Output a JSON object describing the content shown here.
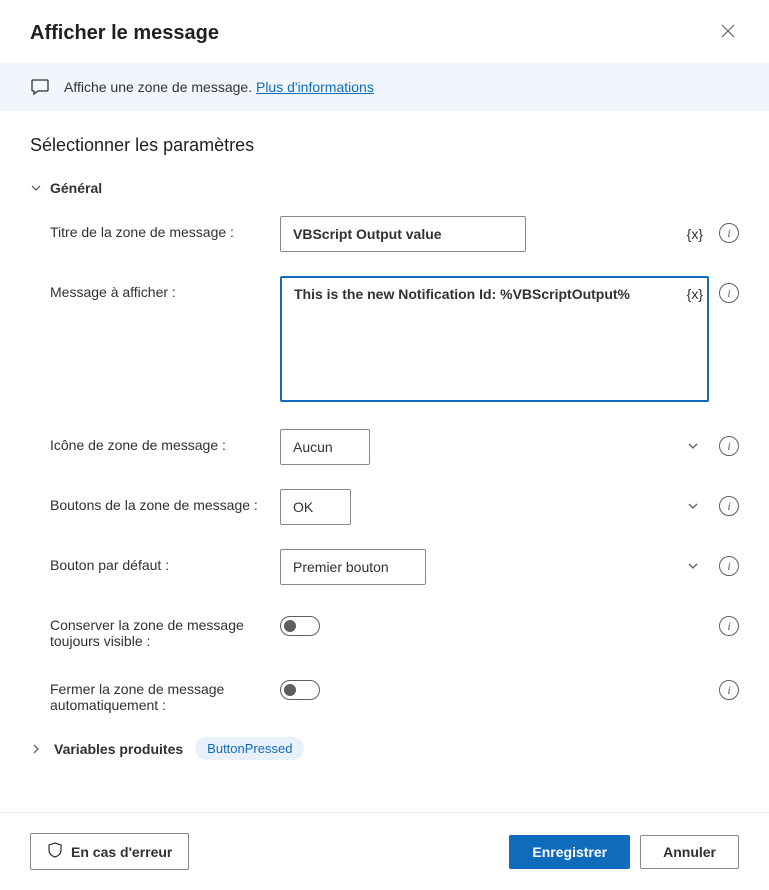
{
  "header": {
    "title": "Afficher le message"
  },
  "banner": {
    "text": "Affiche une zone de message. ",
    "link_text": "Plus d'informations"
  },
  "section_title": "Sélectionner les paramètres",
  "group": {
    "label": "Général"
  },
  "fields": {
    "title": {
      "label": "Titre de la zone de message :",
      "value": "VBScript Output value",
      "var_btn": "{x}"
    },
    "message": {
      "label": "Message à afficher :",
      "value": "This is the new Notification Id: %VBScriptOutput%",
      "var_btn": "{x}"
    },
    "icon": {
      "label": "Icône de zone de message :",
      "value": "Aucun"
    },
    "buttons": {
      "label": "Boutons de la zone de message :",
      "value": "OK"
    },
    "default_button": {
      "label": "Bouton par défaut :",
      "value": "Premier bouton"
    },
    "keep_visible": {
      "label": "Conserver la zone de message toujours visible :",
      "value": false
    },
    "auto_close": {
      "label": "Fermer la zone de message automatiquement :",
      "value": false
    }
  },
  "variables": {
    "label": "Variables produites",
    "chip": "ButtonPressed"
  },
  "footer": {
    "error_btn": "En cas d'erreur",
    "save_btn": "Enregistrer",
    "cancel_btn": "Annuler"
  }
}
